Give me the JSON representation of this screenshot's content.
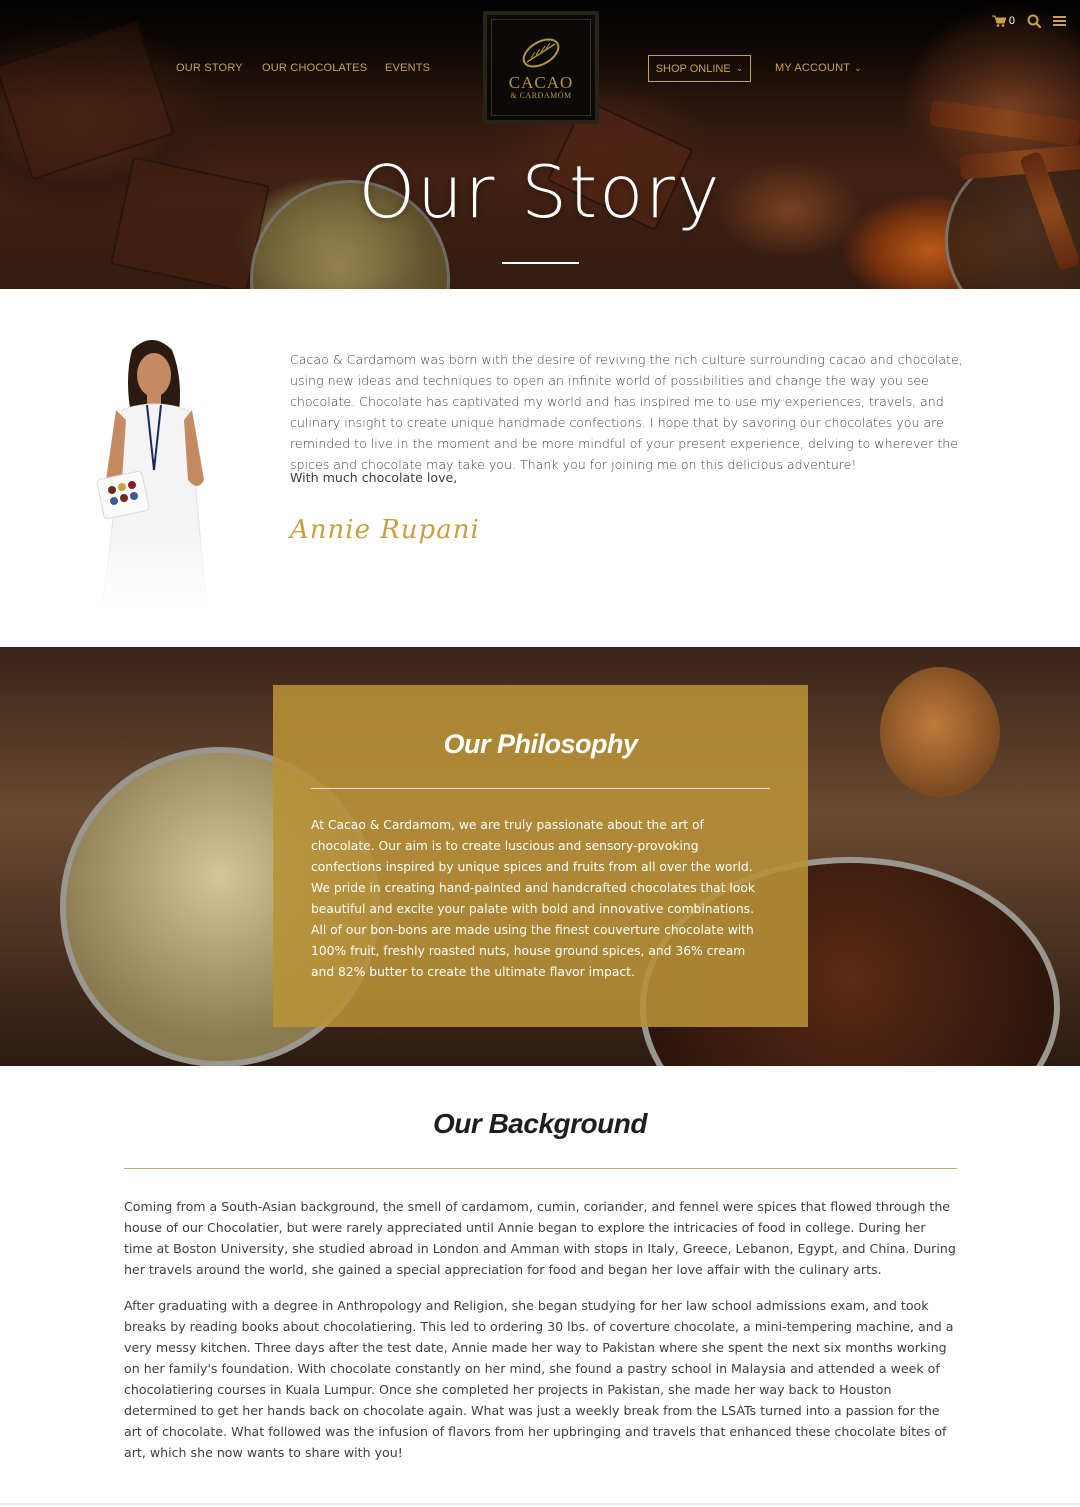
{
  "nav": {
    "left": [
      "OUR STORY",
      "OUR CHOCOLATES",
      "EVENTS"
    ],
    "shop_label": "SHOP ONLINE",
    "account_label": "MY ACCOUNT",
    "cart_count": "0"
  },
  "logo": {
    "line1": "CACAO",
    "line2": "& CARDAMOM"
  },
  "hero": {
    "title": "Our Story"
  },
  "story": {
    "paragraph": "Cacao & Cardamom was born with the desire of reviving the rich culture surrounding cacao and chocolate, using new ideas and techniques to open an infinite world of possibilities and change the way you see chocolate. Chocolate has captivated my world and has inspired me to use my experiences, travels, and culinary insight to create unique handmade confections. I hope that by savoring our chocolates you are reminded to live in the moment and be more mindful of your present experience, delving to wherever the spices and chocolate may take you. Thank you for joining me on this delicious adventure!",
    "closing": "With much chocolate love,",
    "signature": "Annie Rupani"
  },
  "philosophy": {
    "title": "Our Philosophy",
    "text": "At Cacao & Cardamom, we are truly passionate about the art of chocolate. Our aim is to create luscious and sensory-provoking confections inspired by unique spices and fruits from all over the world. We pride in creating hand-painted and handcrafted chocolates that look beautiful and excite your palate with bold and innovative combinations. All of our bon-bons are made using the finest couverture chocolate with 100% fruit, freshly roasted nuts, house ground spices, and 36% cream and 82% butter to create the ultimate flavor impact."
  },
  "background": {
    "title": "Our Background",
    "paragraphs": [
      "Coming from a South-Asian background, the smell of cardamom, cumin, coriander, and fennel were spices that flowed through the house of our Chocolatier, but were rarely appreciated until Annie began to explore the intricacies of food in college. During her time at Boston University, she studied abroad in London and Amman with stops in Italy, Greece, Lebanon, Egypt, and China. During her travels around the world, she gained a special appreciation for food and began her love affair with the culinary arts.",
      "After graduating with a degree in Anthropology and Religion, she began studying for her law school admissions exam, and took breaks by reading books about chocolatiering. This led to ordering 30 lbs. of coverture chocolate, a mini-tempering machine, and a very messy kitchen. Three days after the test date, Annie made her way to Pakistan where she spent the next six months working on her family's foundation. With chocolate constantly on her mind, she found a pastry school in Malaysia and attended a week of chocolatiering courses in Kuala Lumpur. Once she completed her projects in Pakistan, she made her way back to Houston determined to get her hands back on chocolate again. What was just a weekly break from the LSATs turned into a passion for the art of chocolate. What followed was the infusion of flavors from her upbringing and travels that enhanced these chocolate bites of art, which she now wants to share with you!"
    ]
  },
  "colors": {
    "gold": "#c8a24a",
    "philosophy_box": "#b89238",
    "signature": "#c9a040"
  },
  "icons": [
    "cart-icon",
    "search-icon",
    "menu-icon",
    "chevron-down-icon"
  ]
}
